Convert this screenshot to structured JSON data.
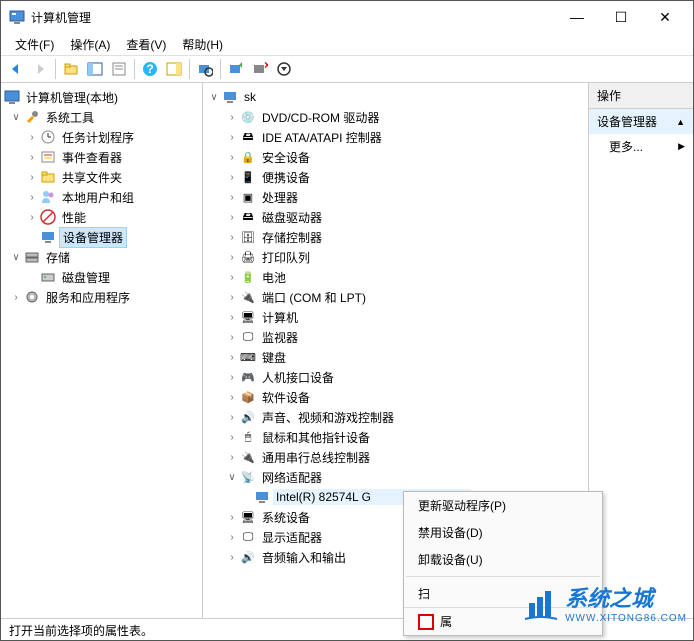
{
  "window": {
    "title": "计算机管理"
  },
  "menus": {
    "file": "文件(F)",
    "action": "操作(A)",
    "view": "查看(V)",
    "help": "帮助(H)"
  },
  "left_tree": {
    "root": "计算机管理(本地)",
    "sys_tools": "系统工具",
    "sys_children": [
      "任务计划程序",
      "事件查看器",
      "共享文件夹",
      "本地用户和组",
      "性能",
      "设备管理器"
    ],
    "storage": "存储",
    "storage_children": [
      "磁盘管理"
    ],
    "services": "服务和应用程序"
  },
  "dev_tree": {
    "root": "sk",
    "items": [
      "DVD/CD-ROM 驱动器",
      "IDE ATA/ATAPI 控制器",
      "安全设备",
      "便携设备",
      "处理器",
      "磁盘驱动器",
      "存储控制器",
      "打印队列",
      "电池",
      "端口 (COM 和 LPT)",
      "计算机",
      "监视器",
      "键盘",
      "人机接口设备",
      "软件设备",
      "声音、视频和游戏控制器",
      "鼠标和其他指针设备",
      "通用串行总线控制器",
      "网络适配器"
    ],
    "net_child": "Intel(R) 82574L G",
    "tail": [
      "系统设备",
      "显示适配器",
      "音频输入和输出"
    ]
  },
  "actions": {
    "header": "操作",
    "item": "设备管理器",
    "more": "更多..."
  },
  "ctx": {
    "update": "更新驱动程序(P)",
    "disable": "禁用设备(D)",
    "uninstall": "卸载设备(U)",
    "scan": "扫",
    "prop": "属"
  },
  "status": "打开当前选择项的属性表。",
  "watermark": {
    "text": "系统之城",
    "url": "WWW.XITONG86.COM"
  }
}
